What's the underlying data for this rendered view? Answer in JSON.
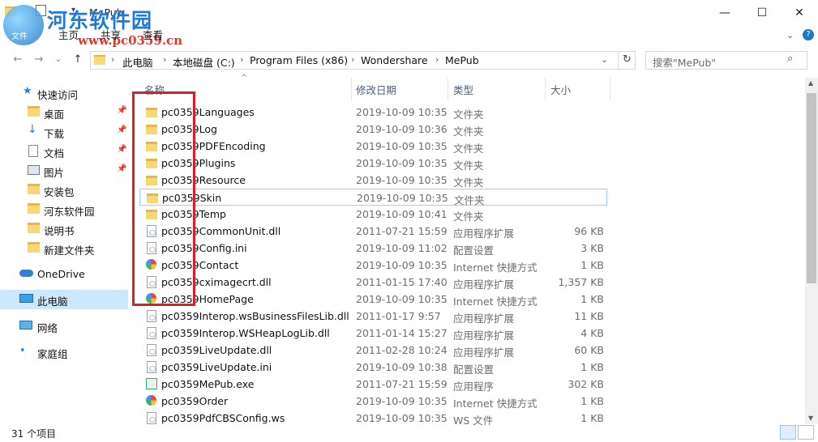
{
  "window": {
    "title": "MePub",
    "minimize": "—",
    "maximize": "☐",
    "close": "✕"
  },
  "watermark": {
    "line1": "河东软件园",
    "line2": "www.pc0359.cn",
    "logo_text": "文件"
  },
  "ribbon": {
    "tabs": [
      "主页",
      "共享",
      "查看"
    ]
  },
  "nav": {
    "back": "←",
    "forward": "→",
    "recent": "⌄",
    "up": "↑",
    "refresh": "↻",
    "history": "⌄",
    "breadcrumbs": [
      "此电脑",
      "本地磁盘 (C:)",
      "Program Files (x86)",
      "Wondershare",
      "MePub"
    ],
    "search_placeholder": "搜索\"MePub\""
  },
  "sidebar": {
    "items": [
      {
        "label": "快速访问",
        "icon": "star-icon",
        "pinned": false
      },
      {
        "label": "桌面",
        "icon": "folder-icon",
        "pinned": true
      },
      {
        "label": "下载",
        "icon": "download-icon",
        "pinned": true
      },
      {
        "label": "文档",
        "icon": "document-icon",
        "pinned": true
      },
      {
        "label": "图片",
        "icon": "picture-icon",
        "pinned": true
      },
      {
        "label": "安装包",
        "icon": "folder-icon",
        "pinned": false
      },
      {
        "label": "河东软件园",
        "icon": "folder-icon",
        "pinned": false
      },
      {
        "label": "说明书",
        "icon": "folder-icon",
        "pinned": false
      },
      {
        "label": "新建文件夹",
        "icon": "folder-icon",
        "pinned": false
      },
      {
        "label": "OneDrive",
        "icon": "cloud-icon",
        "pinned": false
      },
      {
        "label": "此电脑",
        "icon": "computer-icon",
        "pinned": false,
        "selected": true
      },
      {
        "label": "网络",
        "icon": "network-icon",
        "pinned": false
      },
      {
        "label": "家庭组",
        "icon": "homegroup-icon",
        "pinned": false
      }
    ]
  },
  "columns": {
    "name": "名称",
    "date": "修改日期",
    "type": "类型",
    "size": "大小",
    "sort_indicator": "^"
  },
  "files": [
    {
      "name": "pc0359Languages",
      "date": "2019-10-09 10:35",
      "type": "文件夹",
      "size": "",
      "icon": "folder"
    },
    {
      "name": "pc0359Log",
      "date": "2019-10-09 10:36",
      "type": "文件夹",
      "size": "",
      "icon": "folder"
    },
    {
      "name": "pc0359PDFEncoding",
      "date": "2019-10-09 10:35",
      "type": "文件夹",
      "size": "",
      "icon": "folder"
    },
    {
      "name": "pc0359Plugins",
      "date": "2019-10-09 10:35",
      "type": "文件夹",
      "size": "",
      "icon": "folder"
    },
    {
      "name": "pc0359Resource",
      "date": "2019-10-09 10:35",
      "type": "文件夹",
      "size": "",
      "icon": "folder"
    },
    {
      "name": "pc0359Skin",
      "date": "2019-10-09 10:35",
      "type": "文件夹",
      "size": "",
      "icon": "folder"
    },
    {
      "name": "pc0359Temp",
      "date": "2019-10-09 10:41",
      "type": "文件夹",
      "size": "",
      "icon": "folder"
    },
    {
      "name": "pc0359CommonUnit.dll",
      "date": "2011-07-21 15:59",
      "type": "应用程序扩展",
      "size": "96 KB",
      "icon": "doc"
    },
    {
      "name": "pc0359Config.ini",
      "date": "2019-10-09 11:02",
      "type": "配置设置",
      "size": "3 KB",
      "icon": "doc"
    },
    {
      "name": "pc0359Contact",
      "date": "2019-10-09 10:35",
      "type": "Internet 快捷方式",
      "size": "1 KB",
      "icon": "link"
    },
    {
      "name": "pc0359cximagecrt.dll",
      "date": "2011-01-15 17:40",
      "type": "应用程序扩展",
      "size": "1,357 KB",
      "icon": "doc"
    },
    {
      "name": "pc0359HomePage",
      "date": "2019-10-09 10:35",
      "type": "Internet 快捷方式",
      "size": "1 KB",
      "icon": "link"
    },
    {
      "name": "pc0359Interop.wsBusinessFilesLib.dll",
      "date": "2011-01-17 9:57",
      "type": "应用程序扩展",
      "size": "11 KB",
      "icon": "doc"
    },
    {
      "name": "pc0359Interop.WSHeapLogLib.dll",
      "date": "2011-01-14 15:27",
      "type": "应用程序扩展",
      "size": "4 KB",
      "icon": "doc"
    },
    {
      "name": "pc0359LiveUpdate.dll",
      "date": "2011-02-28 10:24",
      "type": "应用程序扩展",
      "size": "60 KB",
      "icon": "doc"
    },
    {
      "name": "pc0359LiveUpdate.ini",
      "date": "2019-10-09 10:38",
      "type": "配置设置",
      "size": "1 KB",
      "icon": "doc"
    },
    {
      "name": "pc0359MePub.exe",
      "date": "2011-07-21 15:59",
      "type": "应用程序",
      "size": "302 KB",
      "icon": "exe"
    },
    {
      "name": "pc0359Order",
      "date": "2019-10-09 10:35",
      "type": "Internet 快捷方式",
      "size": "1 KB",
      "icon": "link"
    },
    {
      "name": "pc0359PdfCBSConfig.ws",
      "date": "2019-10-09 10:35",
      "type": "WS 文件",
      "size": "1 KB",
      "icon": "doc"
    }
  ],
  "status": {
    "item_count": "31 个项目"
  },
  "colors": {
    "selection": "#cce8ff",
    "focus_border": "#99d1ff",
    "highlight_box": "#d8202a"
  }
}
